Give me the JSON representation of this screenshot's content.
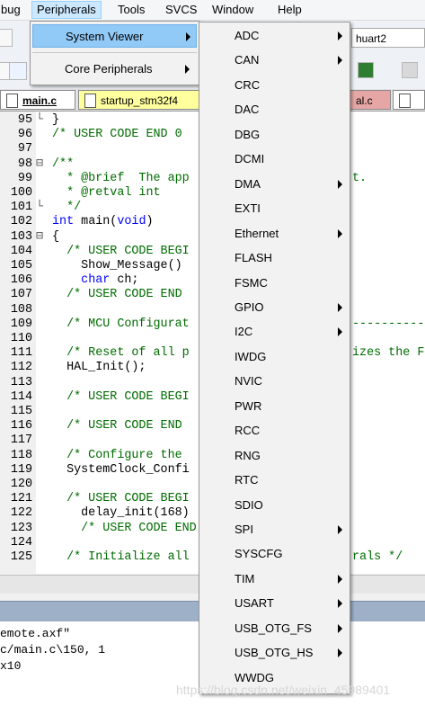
{
  "menubar": {
    "items": [
      "bug",
      "Peripherals",
      "Tools",
      "SVCS",
      "Window",
      "Help"
    ]
  },
  "toolbar": {
    "combo_value": "huart2"
  },
  "tabs": [
    "main.c",
    "startup_stm32f4",
    "al.c"
  ],
  "editor": {
    "lines": [
      {
        "n": "95",
        "fold": "└",
        "segs": [
          [
            "}",
            "plain"
          ]
        ]
      },
      {
        "n": "96",
        "fold": "",
        "segs": [
          [
            "/* USER CODE END 0",
            "comment"
          ]
        ]
      },
      {
        "n": "97",
        "fold": "",
        "segs": [
          [
            "",
            "plain"
          ]
        ]
      },
      {
        "n": "98",
        "fold": "⊟",
        "segs": [
          [
            "/**",
            "comment"
          ]
        ]
      },
      {
        "n": "99",
        "fold": "",
        "segs": [
          [
            "  * @brief  The app",
            "comment"
          ]
        ]
      },
      {
        "n": "100",
        "fold": "",
        "segs": [
          [
            "  * @retval int",
            "comment"
          ]
        ]
      },
      {
        "n": "101",
        "fold": "└",
        "segs": [
          [
            "  */",
            "comment"
          ]
        ]
      },
      {
        "n": "102",
        "fold": "",
        "segs": [
          [
            "int ",
            "kw"
          ],
          [
            "main(",
            "plain"
          ],
          [
            "void",
            "kw"
          ],
          [
            ")",
            "plain"
          ]
        ]
      },
      {
        "n": "103",
        "fold": "⊟",
        "segs": [
          [
            "{",
            "plain"
          ]
        ]
      },
      {
        "n": "104",
        "fold": "",
        "segs": [
          [
            "  /* USER CODE BEGI",
            "comment"
          ]
        ]
      },
      {
        "n": "105",
        "fold": "",
        "segs": [
          [
            "    Show_Message()",
            "plain"
          ]
        ]
      },
      {
        "n": "106",
        "fold": "",
        "segs": [
          [
            "    ",
            "plain"
          ],
          [
            "char ",
            "kw"
          ],
          [
            "ch;",
            "plain"
          ]
        ]
      },
      {
        "n": "107",
        "fold": "",
        "segs": [
          [
            "  /* USER CODE END",
            "comment"
          ]
        ]
      },
      {
        "n": "108",
        "fold": "",
        "segs": [
          [
            "",
            "plain"
          ]
        ]
      },
      {
        "n": "109",
        "fold": "",
        "segs": [
          [
            "  /* MCU Configurat",
            "comment"
          ]
        ]
      },
      {
        "n": "110",
        "fold": "",
        "segs": [
          [
            "",
            "plain"
          ]
        ]
      },
      {
        "n": "111",
        "fold": "",
        "segs": [
          [
            "  /* Reset of all p",
            "comment"
          ]
        ]
      },
      {
        "n": "112",
        "fold": "",
        "segs": [
          [
            "  HAL_Init();",
            "plain"
          ]
        ]
      },
      {
        "n": "113",
        "fold": "",
        "segs": [
          [
            "",
            "plain"
          ]
        ]
      },
      {
        "n": "114",
        "fold": "",
        "segs": [
          [
            "  /* USER CODE BEGI",
            "comment"
          ]
        ]
      },
      {
        "n": "115",
        "fold": "",
        "segs": [
          [
            "",
            "plain"
          ]
        ]
      },
      {
        "n": "116",
        "fold": "",
        "segs": [
          [
            "  /* USER CODE END",
            "comment"
          ]
        ]
      },
      {
        "n": "117",
        "fold": "",
        "segs": [
          [
            "",
            "plain"
          ]
        ]
      },
      {
        "n": "118",
        "fold": "",
        "segs": [
          [
            "  /* Configure the",
            "comment"
          ]
        ]
      },
      {
        "n": "119",
        "fold": "",
        "segs": [
          [
            "  SystemClock_Confi",
            "plain"
          ]
        ]
      },
      {
        "n": "120",
        "fold": "",
        "segs": [
          [
            "",
            "plain"
          ]
        ]
      },
      {
        "n": "121",
        "fold": "",
        "segs": [
          [
            "  /* USER CODE BEGI",
            "comment"
          ]
        ]
      },
      {
        "n": "122",
        "fold": "",
        "segs": [
          [
            "    delay_init(168)",
            "plain"
          ]
        ]
      },
      {
        "n": "123",
        "fold": "",
        "segs": [
          [
            "    /* USER CODE END",
            "comment"
          ]
        ]
      },
      {
        "n": "124",
        "fold": "",
        "segs": [
          [
            "",
            "plain"
          ]
        ]
      },
      {
        "n": "125",
        "fold": "",
        "segs": [
          [
            "  /* Initialize all",
            "comment"
          ]
        ]
      }
    ],
    "right_fragments": [
      {
        "row": 4,
        "text": "t.",
        "kind": "comment"
      },
      {
        "row": 14,
        "text": "-----------",
        "kind": "comment"
      },
      {
        "row": 16,
        "text": "izes the F",
        "kind": "comment"
      },
      {
        "row": 30,
        "text": "rals */",
        "kind": "comment"
      }
    ]
  },
  "output": {
    "lines": [
      "emote.axf\"",
      "c/main.c\\150, 1",
      "x10"
    ]
  },
  "menu_peripherals": {
    "items": [
      {
        "label": "System Viewer",
        "highlighted": true,
        "submenu": true
      },
      {
        "label": "Core Peripherals",
        "highlighted": false,
        "submenu": true
      }
    ]
  },
  "menu_system_viewer": {
    "items": [
      {
        "label": "ADC",
        "submenu": true
      },
      {
        "label": "CAN",
        "submenu": true
      },
      {
        "label": "CRC",
        "submenu": false
      },
      {
        "label": "DAC",
        "submenu": false
      },
      {
        "label": "DBG",
        "submenu": false
      },
      {
        "label": "DCMI",
        "submenu": false
      },
      {
        "label": "DMA",
        "submenu": true
      },
      {
        "label": "EXTI",
        "submenu": false
      },
      {
        "label": "Ethernet",
        "submenu": true
      },
      {
        "label": "FLASH",
        "submenu": false
      },
      {
        "label": "FSMC",
        "submenu": false
      },
      {
        "label": "GPIO",
        "submenu": true
      },
      {
        "label": "I2C",
        "submenu": true
      },
      {
        "label": "IWDG",
        "submenu": false
      },
      {
        "label": "NVIC",
        "submenu": false
      },
      {
        "label": "PWR",
        "submenu": false
      },
      {
        "label": "RCC",
        "submenu": false
      },
      {
        "label": "RNG",
        "submenu": false
      },
      {
        "label": "RTC",
        "submenu": false
      },
      {
        "label": "SDIO",
        "submenu": false
      },
      {
        "label": "SPI",
        "submenu": true
      },
      {
        "label": "SYSCFG",
        "submenu": false
      },
      {
        "label": "TIM",
        "submenu": true
      },
      {
        "label": "USART",
        "submenu": true
      },
      {
        "label": "USB_OTG_FS",
        "submenu": true
      },
      {
        "label": "USB_OTG_HS",
        "submenu": true
      },
      {
        "label": "WWDG",
        "submenu": false
      }
    ]
  },
  "watermark": "https://blog.csdn.net/weixin_45989401"
}
